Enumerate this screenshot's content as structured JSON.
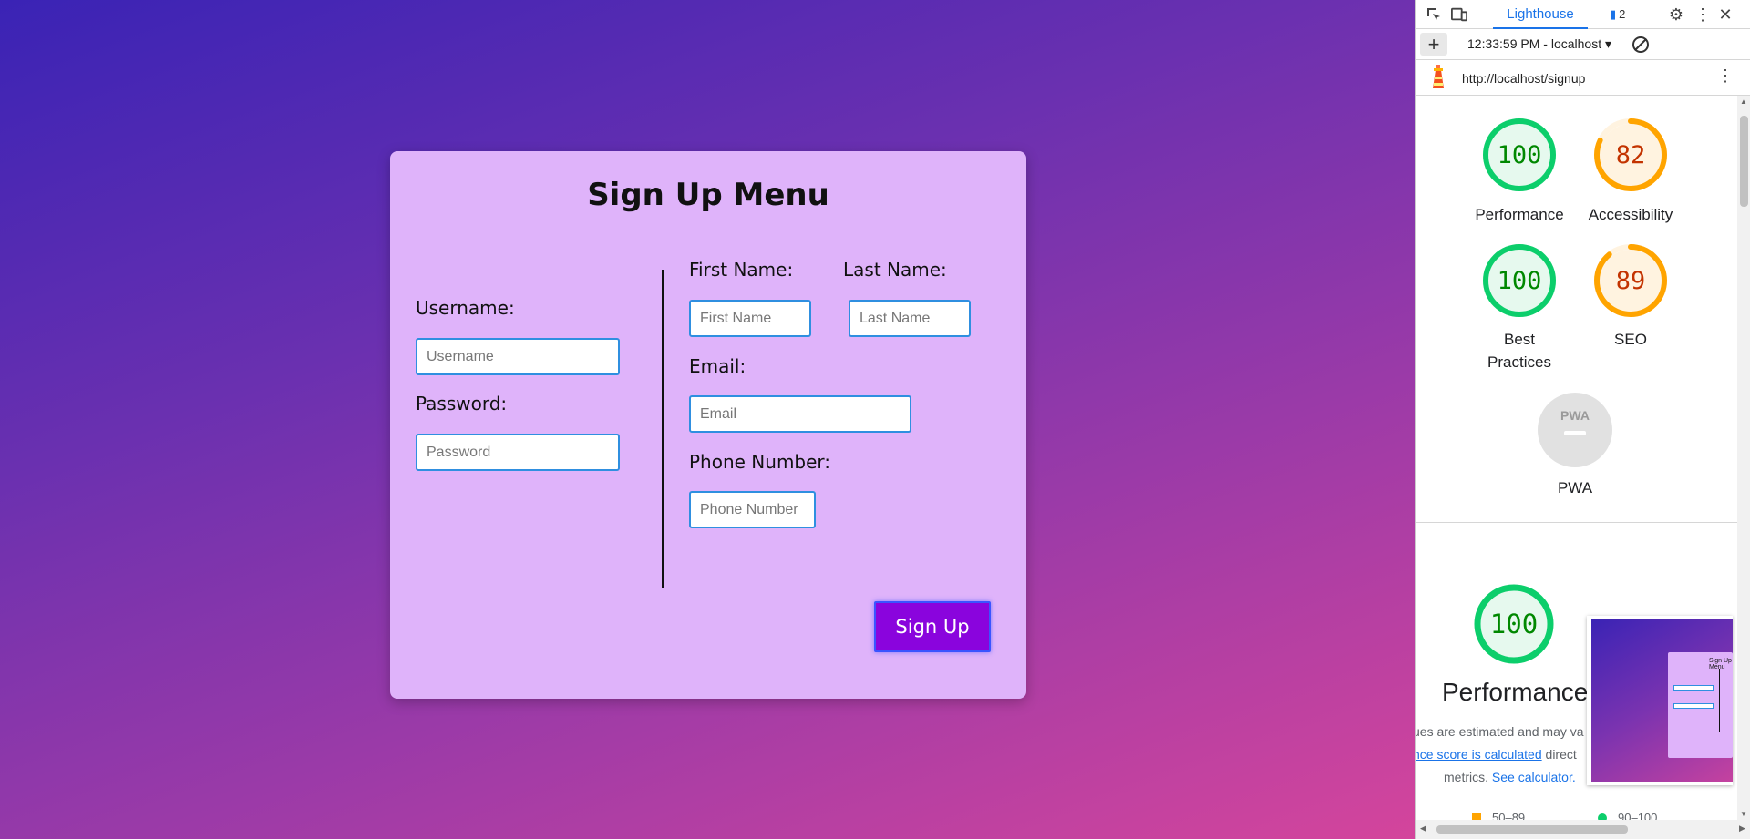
{
  "form": {
    "title": "Sign Up Menu",
    "username_label": "Username:",
    "username_placeholder": "Username",
    "password_label": "Password:",
    "password_placeholder": "Password",
    "first_name_label": "First Name:",
    "first_name_placeholder": "First Name",
    "last_name_label": "Last Name:",
    "last_name_placeholder": "Last Name",
    "email_label": "Email:",
    "email_placeholder": "Email",
    "phone_label": "Phone Number:",
    "phone_placeholder": "Phone Number",
    "submit_label": "Sign Up"
  },
  "devtools": {
    "tab_label": "Lighthouse",
    "issues_count": "2",
    "report_select": "12:33:59 PM - localhost ▾",
    "url": "http://localhost/signup",
    "scores": [
      {
        "label": "Performance",
        "value": "100",
        "score": 100,
        "color": "#0cce6b",
        "text_color": "#008800"
      },
      {
        "label": "Accessibility",
        "value": "82",
        "score": 82,
        "color": "#ffa400",
        "text_color": "#c33300"
      },
      {
        "label": "Best Practices",
        "value": "100",
        "score": 100,
        "color": "#0cce6b",
        "text_color": "#008800"
      },
      {
        "label": "SEO",
        "value": "89",
        "score": 89,
        "color": "#ffa400",
        "text_color": "#c33300"
      }
    ],
    "pwa_badge": "PWA",
    "pwa_label": "PWA",
    "performance_score": {
      "value": "100",
      "score": 100,
      "color": "#0cce6b",
      "text_color": "#008800"
    },
    "performance_title": "Performance",
    "note_line1": "ues are estimated and may va",
    "note_link1": "nce score is calculated",
    "note_line2_after": " direct",
    "note_line3_before": "metrics. ",
    "note_link2": "See calculator.",
    "legend": [
      {
        "label": "50–89"
      },
      {
        "label": "90–100"
      }
    ]
  },
  "colors": {
    "card_bg": "#dfb3fa",
    "button_bg": "#8a04dd",
    "input_border": "#2f8fe0",
    "accent_blue": "#1a73e8"
  }
}
